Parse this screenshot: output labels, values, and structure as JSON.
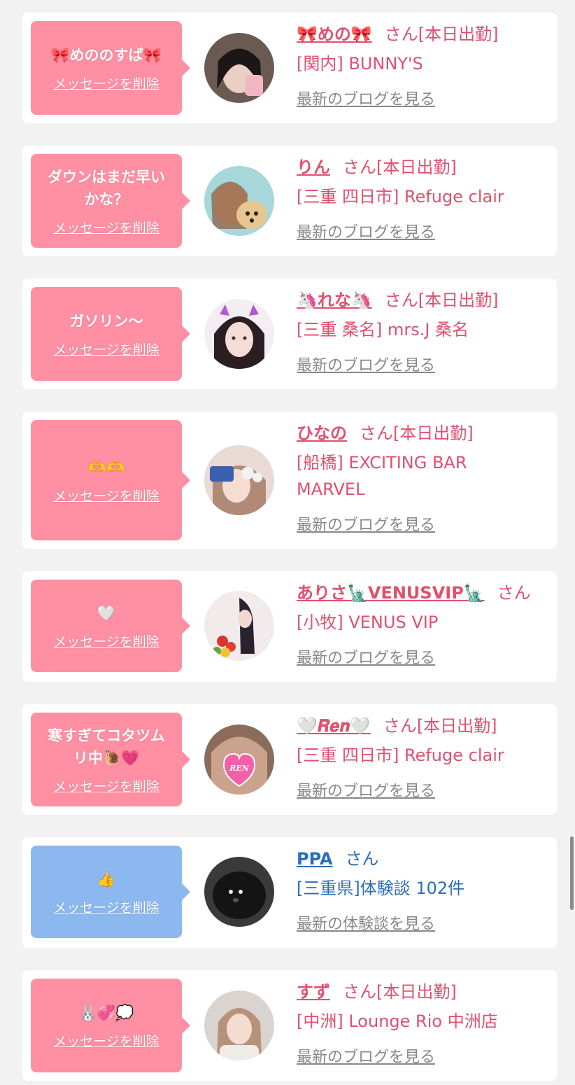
{
  "delete_label": "メッセージを削除",
  "entries": [
    {
      "message": "🎀めののすぱ🎀",
      "name": "🎀めの🎀",
      "san": "さん",
      "status": "[本日出勤]",
      "shop": "[関内] BUNNY'S",
      "link": "最新のブログを見る",
      "color": "pink"
    },
    {
      "message": "ダウンはまだ早い\nかな？",
      "name": "りん",
      "san": "さん",
      "status": "[本日出勤]",
      "shop": "[三重 四日市] Refuge clair",
      "link": "最新のブログを見る",
      "color": "pink"
    },
    {
      "message": "ガソリン〜",
      "name": "🦄れな🦄",
      "san": "さん",
      "status": "[本日出勤]",
      "shop": "[三重 桑名] mrs.J 桑名",
      "link": "最新のブログを見る",
      "color": "pink"
    },
    {
      "message": "🫶🫶",
      "name": "ひなの",
      "san": "さん",
      "status": "[本日出勤]",
      "shop": "[船橋] EXCITING BAR MARVEL",
      "link": "最新のブログを見る",
      "color": "pink"
    },
    {
      "message": "🤍",
      "name": "ありさ🗽VENUSVIP🗽",
      "san": "さん",
      "status": "",
      "shop": "[小牧] VENUS VIP",
      "link": "最新のブログを見る",
      "color": "pink"
    },
    {
      "message": "寒すぎてコタツム\nリ中🐌💗",
      "name": "🤍𝑹𝒆𝒏🤍",
      "san": "さん",
      "status": "[本日出勤]",
      "shop": "[三重 四日市] Refuge clair",
      "link": "最新のブログを見る",
      "color": "pink"
    },
    {
      "message": "👍",
      "name": "PPA",
      "san": "さん",
      "status": "",
      "shop": "[三重県]体験談 102件",
      "link": "最新の体験談を見る",
      "color": "blue"
    },
    {
      "message": "🐰💞💭",
      "name": "すず",
      "san": "さん",
      "status": "[本日出勤]",
      "shop": "[中洲] Lounge Rio 中洲店",
      "link": "最新のブログを見る",
      "color": "pink"
    }
  ]
}
